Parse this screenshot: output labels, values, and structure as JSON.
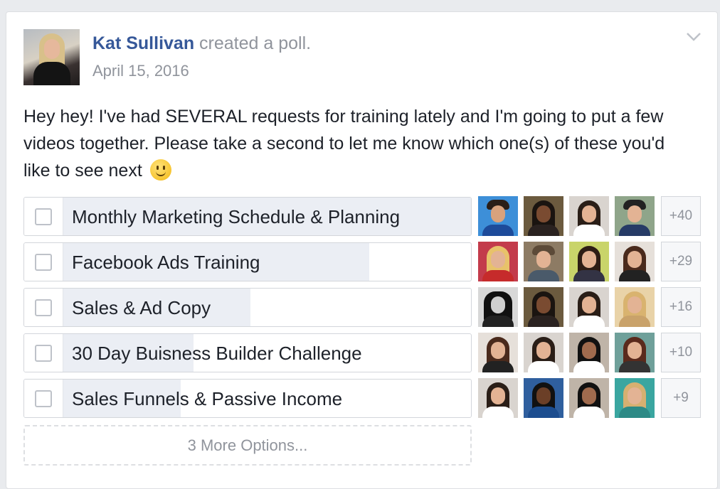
{
  "post": {
    "author": "Kat Sullivan",
    "action": "created a poll.",
    "date": "April 15, 2016",
    "text": "Hey hey! I've had SEVERAL requests for training lately and I'm going to put a few videos together. Please take a second to let me know which one(s) of these you'd like to see next"
  },
  "poll": {
    "options": [
      {
        "label": "Monthly Marketing Schedule & Planning",
        "fill": 1.0,
        "more": "+40"
      },
      {
        "label": "Facebook Ads Training",
        "fill": 0.75,
        "more": "+29"
      },
      {
        "label": "Sales & Ad Copy",
        "fill": 0.46,
        "more": "+16"
      },
      {
        "label": "30 Day Buisness Builder Challenge",
        "fill": 0.32,
        "more": "+10"
      },
      {
        "label": "Sales Funnels & Passive Income",
        "fill": 0.29,
        "more": "+9"
      }
    ],
    "more_options": "3 More Options..."
  },
  "colors": {
    "name": "#365899",
    "muted": "#90949c",
    "poll_fill": "#ebeef4"
  }
}
